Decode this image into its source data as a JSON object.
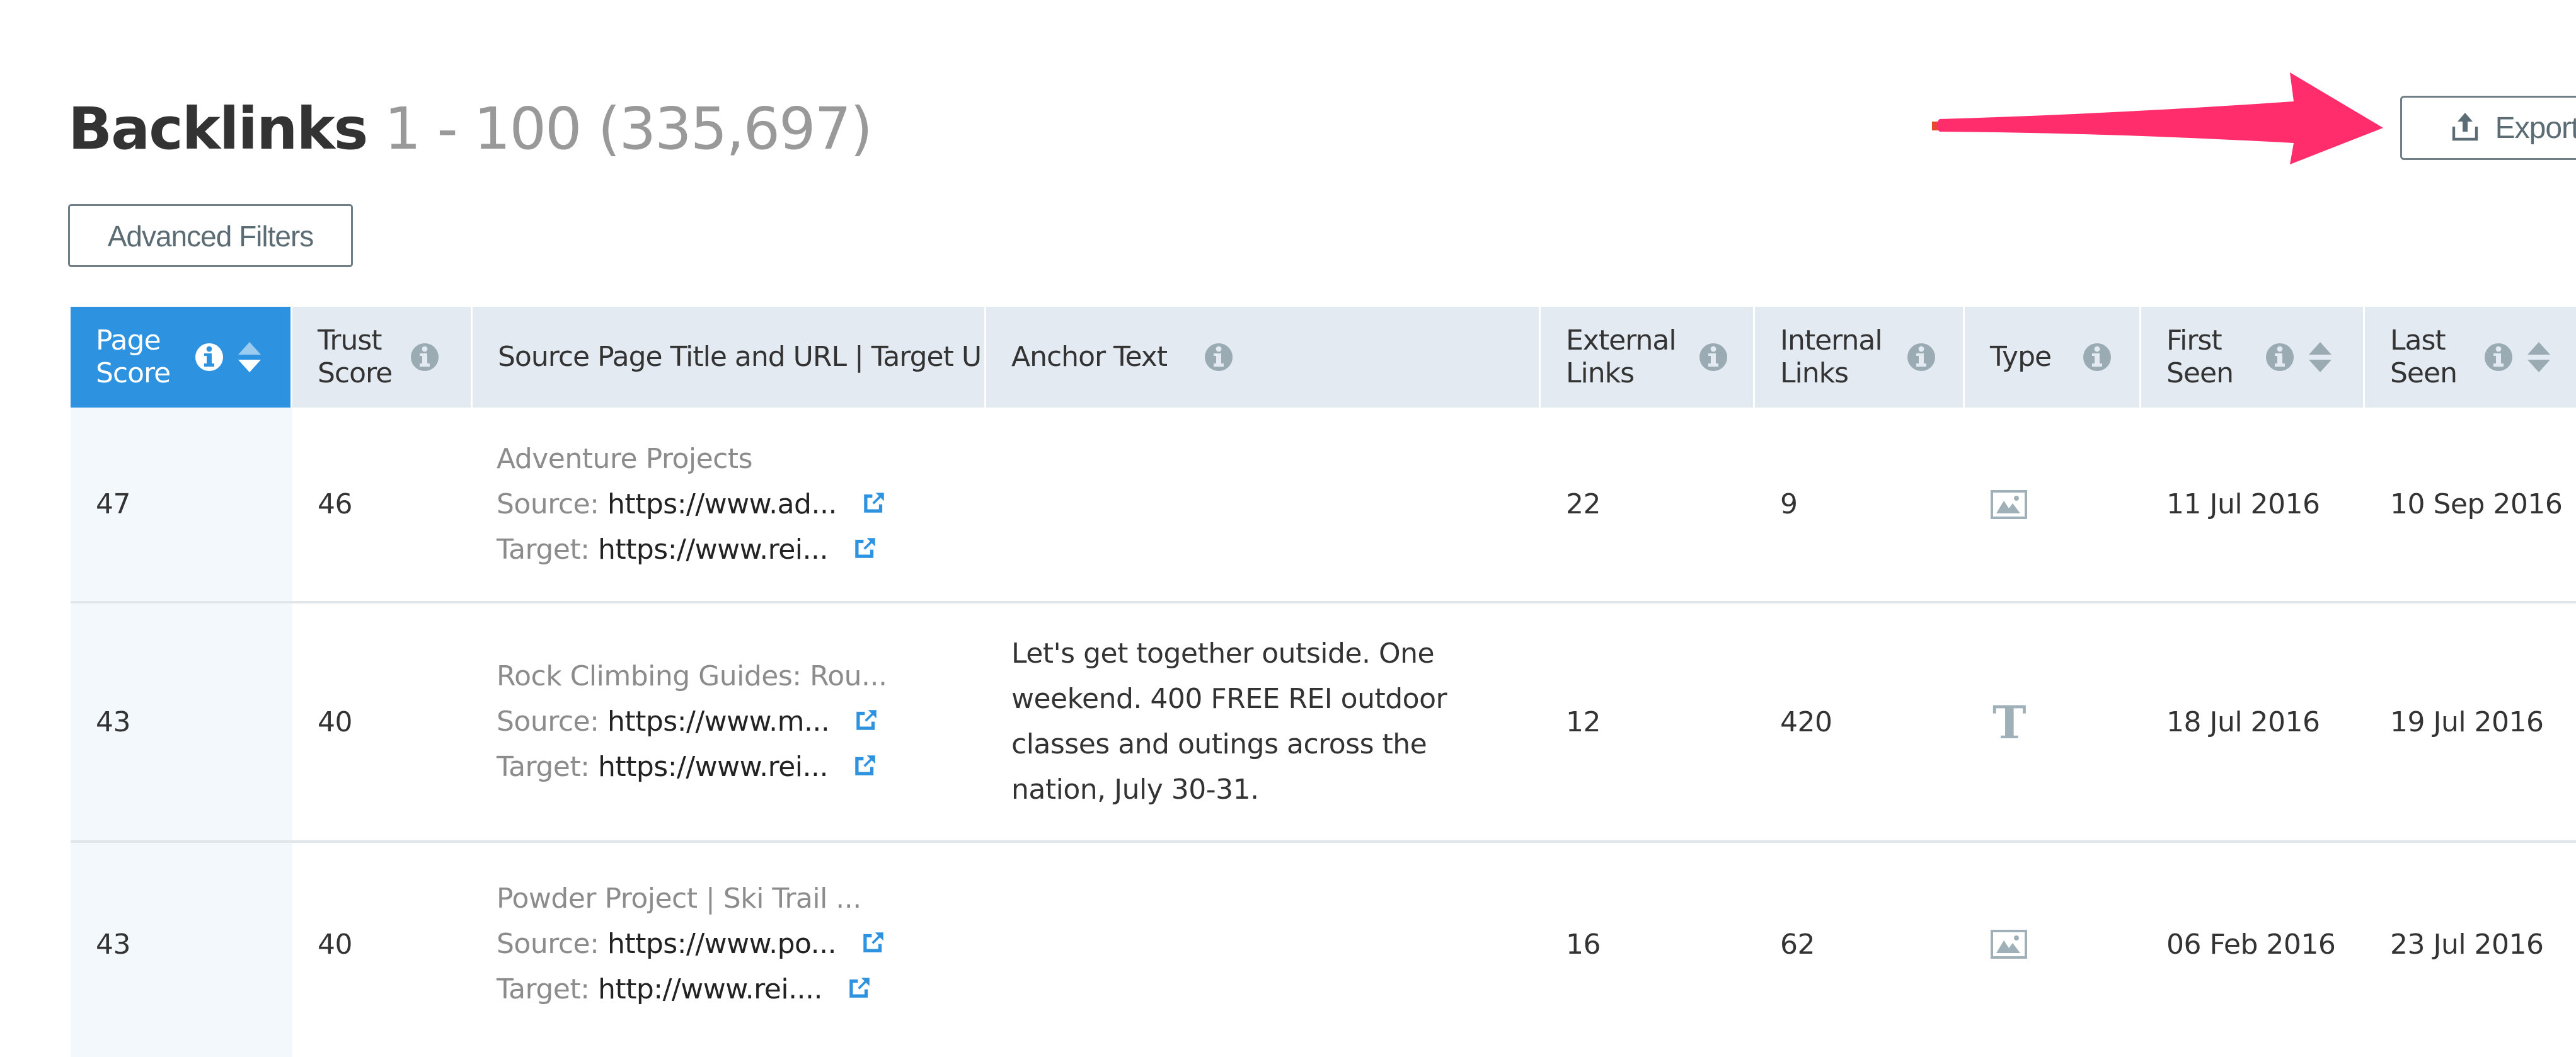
{
  "header": {
    "title": "Backlinks",
    "range": "1 - 100 (335,697)"
  },
  "toolbar": {
    "advanced_filters_label": "Advanced Filters",
    "export_label": "Export",
    "export_icon": "upload-icon"
  },
  "annotation": {
    "type": "arrow",
    "color": "#ff2d6c",
    "points_to": "export-button"
  },
  "colors": {
    "accent": "#2d93e0",
    "header_bg": "#e3eaf1",
    "icon_gray": "#9aabb3",
    "link_icon": "#2d93e0"
  },
  "table": {
    "columns": [
      {
        "label": "Page Score",
        "info": true,
        "sortable": true,
        "active": true
      },
      {
        "label": "Trust Score",
        "info": true,
        "sortable": false
      },
      {
        "label": "Source Page Title and URL | Target URL",
        "info": false,
        "sortable": false
      },
      {
        "label": "Anchor Text",
        "info": true,
        "sortable": false
      },
      {
        "label": "External Links",
        "info": true,
        "sortable": false
      },
      {
        "label": "Internal Links",
        "info": true,
        "sortable": false
      },
      {
        "label": "Type",
        "info": true,
        "sortable": false
      },
      {
        "label": "First Seen",
        "info": true,
        "sortable": true
      },
      {
        "label": "Last Seen",
        "info": true,
        "sortable": true
      }
    ],
    "header_lines": {
      "page_score": [
        "Page",
        "Score"
      ],
      "trust_score": [
        "Trust",
        "Score"
      ],
      "source": "Source Page Title and URL | Target U",
      "anchor": "Anchor Text",
      "external": [
        "External",
        "Links"
      ],
      "internal": [
        "Internal",
        "Links"
      ],
      "type": "Type",
      "first_seen": [
        "First",
        "Seen"
      ],
      "last_seen": [
        "Last",
        "Seen"
      ]
    },
    "source_key": "Source:",
    "target_key": "Target:",
    "rows": [
      {
        "page_score": "47",
        "trust_score": "46",
        "page_title": "Adventure Projects",
        "source_url": "https://www.ad...",
        "target_url": "https://www.rei...",
        "anchor_text": "",
        "external_links": "22",
        "internal_links": "9",
        "type": "image",
        "first_seen": "11 Jul 2016",
        "last_seen": "10 Sep 2016"
      },
      {
        "page_score": "43",
        "trust_score": "40",
        "page_title": "Rock Climbing Guides: Rou...",
        "source_url": "https://www.m...",
        "target_url": "https://www.rei...",
        "anchor_text": "Let's get together outside. One weekend. 400 FREE REI outdoor classes and outings across the nation, July 30-31.",
        "external_links": "12",
        "internal_links": "420",
        "type": "text",
        "type_glyph": "T",
        "first_seen": "18 Jul 2016",
        "last_seen": "19 Jul 2016"
      },
      {
        "page_score": "43",
        "trust_score": "40",
        "page_title": "Powder Project | Ski Trail ...",
        "source_url": "https://www.po...",
        "target_url": "http://www.rei....",
        "anchor_text": "",
        "external_links": "16",
        "internal_links": "62",
        "type": "image",
        "first_seen": "06 Feb 2016",
        "last_seen": "23 Jul 2016"
      }
    ]
  }
}
